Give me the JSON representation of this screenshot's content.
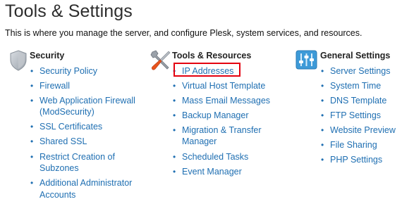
{
  "page": {
    "title": "Tools & Settings",
    "subtitle": "This is where you manage the server, and configure Plesk, system services, and resources."
  },
  "colors": {
    "link": "#1f6fb2",
    "highlight_border": "#e4000f",
    "title": "#2d2d2d"
  },
  "columns": {
    "security": {
      "icon": "shield-icon",
      "title": "Security",
      "items": [
        "Security Policy",
        "Firewall",
        "Web Application Firewall (ModSecurity)",
        "SSL Certificates",
        "Shared SSL",
        "Restrict Creation of Subzones",
        "Additional Administrator Accounts"
      ]
    },
    "tools": {
      "icon": "tools-icon",
      "title": "Tools & Resources",
      "items": [
        "IP Addresses",
        "Virtual Host Template",
        "Mass Email Messages",
        "Backup Manager",
        "Migration & Transfer Manager",
        "Scheduled Tasks",
        "Event Manager"
      ],
      "highlighted_item": "IP Addresses"
    },
    "general": {
      "icon": "sliders-icon",
      "title": "General Settings",
      "items": [
        "Server Settings",
        "System Time",
        "DNS Template",
        "FTP Settings",
        "Website Preview",
        "File Sharing",
        "PHP Settings"
      ]
    }
  }
}
